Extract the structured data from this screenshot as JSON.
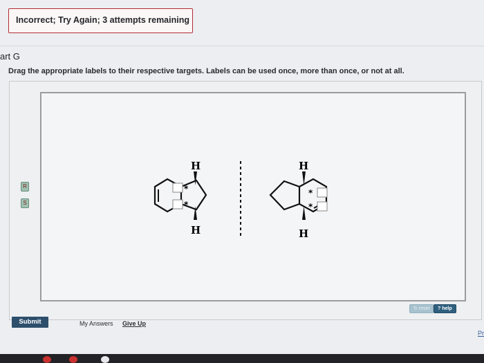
{
  "feedback": {
    "text": "Incorrect; Try Again; 3 attempts remaining"
  },
  "part": {
    "title": "art G"
  },
  "instructions": "Drag the appropriate labels to their respective targets. Labels can be used once, more than once, or not at all.",
  "labels": [
    {
      "text": "R"
    },
    {
      "text": "S"
    }
  ],
  "molecule": {
    "left": {
      "top_atom": "H",
      "bottom_atom": "H",
      "stereo_marks": [
        "*",
        "*"
      ]
    },
    "right": {
      "top_atom": "H",
      "bottom_atom": "H",
      "stereo_marks": [
        "*",
        "*"
      ]
    }
  },
  "controls": {
    "reset": "reset",
    "help": "help"
  },
  "footer": {
    "submit": "Submit",
    "my_answers": "My Answers",
    "give_up": "Give Up",
    "corner": "Pr"
  }
}
